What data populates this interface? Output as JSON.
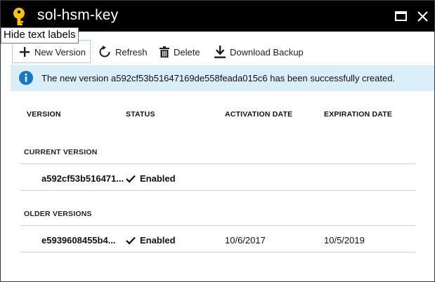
{
  "window": {
    "title": "sol-hsm-key",
    "tooltip": "Hide text labels",
    "icon": "key-icon",
    "controls": [
      "maximize-icon",
      "close-icon"
    ]
  },
  "toolbar": {
    "new_version": "New Version",
    "refresh": "Refresh",
    "delete": "Delete",
    "download_backup": "Download Backup"
  },
  "notification": {
    "message": "The new version a592cf53b51647169de558feada015c6 has been successfully created."
  },
  "table": {
    "columns": [
      "VERSION",
      "STATUS",
      "ACTIVATION DATE",
      "EXPIRATION DATE"
    ],
    "current_label": "CURRENT VERSION",
    "current": {
      "version": "a592cf53b516471...",
      "status": "Enabled",
      "activation": "",
      "expiration": ""
    },
    "older_label": "OLDER VERSIONS",
    "older": [
      {
        "version": "e5939608455b4...",
        "status": "Enabled",
        "activation": "10/6/2017",
        "expiration": "10/5/2019"
      }
    ]
  },
  "colors": {
    "titlebar": "#000000",
    "key_icon": "#f5c400",
    "info_bg": "#d9eef8",
    "info_icon": "#1a78c2"
  }
}
